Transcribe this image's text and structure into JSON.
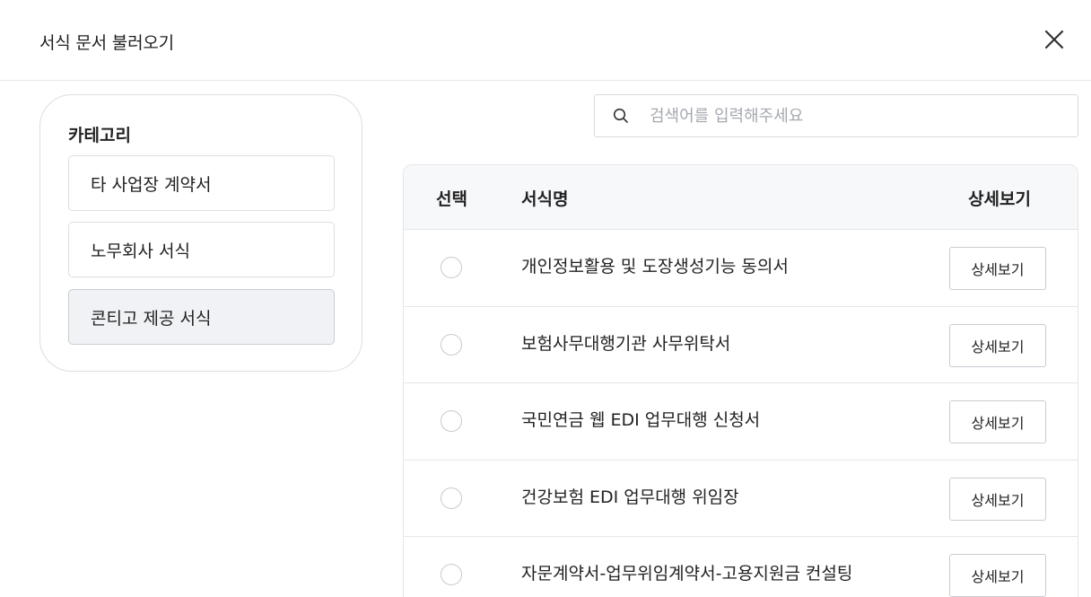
{
  "modal": {
    "title": "서식 문서 불러오기",
    "close_icon": "close-icon"
  },
  "sidebar": {
    "heading": "카테고리",
    "items": [
      {
        "label": "타 사업장 계약서",
        "active": false
      },
      {
        "label": "노무회사 서식",
        "active": false
      },
      {
        "label": "콘티고 제공 서식",
        "active": true
      }
    ]
  },
  "search": {
    "placeholder": "검색어를 입력해주세요",
    "value": "",
    "icon": "search-icon"
  },
  "table": {
    "headers": {
      "select": "선택",
      "name": "서식명",
      "detail": "상세보기"
    },
    "rows": [
      {
        "name": "개인정보활용 및 도장생성기능 동의서",
        "detail_label": "상세보기",
        "selected": false
      },
      {
        "name": "보험사무대행기관 사무위탁서",
        "detail_label": "상세보기",
        "selected": false
      },
      {
        "name": "국민연금 웹 EDI 업무대행 신청서",
        "detail_label": "상세보기",
        "selected": false
      },
      {
        "name": "건강보험 EDI 업무대행 위임장",
        "detail_label": "상세보기",
        "selected": false
      },
      {
        "name": "자문계약서-업무위임계약서-고용지원금 컨설팅",
        "detail_label": "상세보기",
        "selected": false
      }
    ]
  }
}
